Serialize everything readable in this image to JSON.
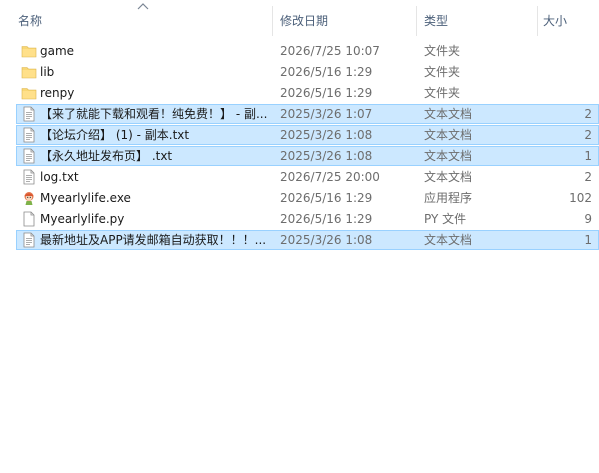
{
  "columns": {
    "name": "名称",
    "modified": "修改日期",
    "type": "类型",
    "size": "大小"
  },
  "sort": {
    "column": "name",
    "indicator": "chevron-up-icon"
  },
  "colors": {
    "selection_fill": "#cce8ff",
    "selection_border": "#99d1ff",
    "header_text": "#4c607a",
    "secondary_text": "#6d6d6d",
    "folder": "#f8d775"
  },
  "files": [
    {
      "name": "game",
      "modified": "2026/7/25 10:07",
      "type": "文件夹",
      "size": "",
      "icon": "folder-icon",
      "selected": false
    },
    {
      "name": "lib",
      "modified": "2026/5/16 1:29",
      "type": "文件夹",
      "size": "",
      "icon": "folder-icon",
      "selected": false
    },
    {
      "name": "renpy",
      "modified": "2026/5/16 1:29",
      "type": "文件夹",
      "size": "",
      "icon": "folder-icon",
      "selected": false
    },
    {
      "name": "【来了就能下载和观看！纯免费！】 - 副...",
      "modified": "2025/3/26 1:07",
      "type": "文本文档",
      "size": "2",
      "icon": "text-file-icon",
      "selected": true
    },
    {
      "name": "【论坛介绍】 (1) - 副本.txt",
      "modified": "2025/3/26 1:08",
      "type": "文本文档",
      "size": "2",
      "icon": "text-file-icon",
      "selected": true
    },
    {
      "name": "【永久地址发布页】 .txt",
      "modified": "2025/3/26 1:08",
      "type": "文本文档",
      "size": "1",
      "icon": "text-file-icon",
      "selected": true
    },
    {
      "name": "log.txt",
      "modified": "2026/7/25 20:00",
      "type": "文本文档",
      "size": "2",
      "icon": "text-file-icon",
      "selected": false
    },
    {
      "name": "Myearlylife.exe",
      "modified": "2026/5/16 1:29",
      "type": "应用程序",
      "size": "102",
      "icon": "app-exe-icon",
      "selected": false
    },
    {
      "name": "Myearlylife.py",
      "modified": "2026/5/16 1:29",
      "type": "PY 文件",
      "size": "9",
      "icon": "py-file-icon",
      "selected": false
    },
    {
      "name": "最新地址及APP请发邮箱自动获取！！！...",
      "modified": "2025/3/26 1:08",
      "type": "文本文档",
      "size": "1",
      "icon": "text-file-icon",
      "selected": true
    }
  ]
}
